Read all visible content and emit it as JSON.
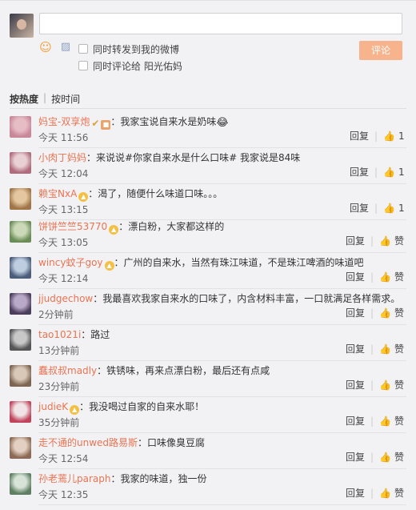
{
  "composer": {
    "input_value": "",
    "option_forward": "同时转发到我的微博",
    "option_comment": "同时评论给 阳光佑妈",
    "submit_label": "评论"
  },
  "sort": {
    "hot": "按热度",
    "separator": "|",
    "time": "按时间"
  },
  "comments": [
    {
      "username": "妈宝-双享炮",
      "badges": [
        "gold-v",
        "gift"
      ],
      "text": "：我家宝说自来水是奶味",
      "emoji": "😂",
      "time": "今天 11:56",
      "reply": "回复",
      "like_label": "1",
      "avatar": [
        "#e6bdc5",
        "#c9879a"
      ]
    },
    {
      "username": "小肉丁妈妈",
      "badges": [],
      "text": "：来说说#你家自来水是什么口味# 我家说是84味",
      "time": "今天 12:04",
      "reply": "回复",
      "like_label": "1",
      "avatar": [
        "#e9d0d5",
        "#b06c7c"
      ]
    },
    {
      "username": "赖宝NxA",
      "badges": [
        "vip"
      ],
      "text": "：渴了，随便什么味道口味。。。",
      "time": "今天 13:15",
      "reply": "回复",
      "like_label": "1",
      "avatar": [
        "#e4c7a0",
        "#a07648"
      ]
    },
    {
      "username": "饼饼竺竺53770",
      "badges": [
        "vip"
      ],
      "text": "：漂白粉，大家都这样的",
      "time": "今天 13:05",
      "reply": "回复",
      "like_label": "赞",
      "avatar": [
        "#cbd9b8",
        "#6b8d57"
      ]
    },
    {
      "username": "wincy蚊子goy",
      "badges": [
        "vip"
      ],
      "text": "：广州的自来水，当然有珠江味道，不是珠江啤酒的味道吧",
      "time": "今天 12:14",
      "reply": "回复",
      "like_label": "赞",
      "avatar": [
        "#bfcde0",
        "#4a5d7a"
      ]
    },
    {
      "username": "jjudgechow",
      "badges": [],
      "text": "：我最喜欢我家自来水的口味了，内含材料丰富，一口就满足各样需求。",
      "time": "2分钟前",
      "reply": "回复",
      "like_label": "赞",
      "avatar": [
        "#b9a9c9",
        "#4b3d5c"
      ]
    },
    {
      "username": "tao1021i",
      "badges": [],
      "text": "：路过",
      "time": "13分钟前",
      "reply": "回复",
      "like_label": "赞",
      "avatar": [
        "#c8c8c8",
        "#555555"
      ]
    },
    {
      "username": "蠢叔叔madly",
      "badges": [],
      "text": "：铁锈味，再来点漂白粉，最后还有点咸",
      "time": "23分钟前",
      "reply": "回复",
      "like_label": "赞",
      "avatar": [
        "#d9c7b7",
        "#7d6552"
      ]
    },
    {
      "username": "judieK",
      "badges": [
        "vip"
      ],
      "text": "：我没喝过自家的自来水耶！",
      "time": "35分钟前",
      "reply": "回复",
      "like_label": "赞",
      "avatar": [
        "#f0e4e6",
        "#c0455c"
      ]
    },
    {
      "username": "走不通的unwed路易斯",
      "badges": [],
      "text": "：口味像臭豆腐",
      "time": "今天 12:54",
      "reply": "回复",
      "like_label": "赞",
      "avatar": [
        "#e3d0c2",
        "#8c6a55"
      ]
    },
    {
      "username": "孙老蔫儿paraph",
      "badges": [],
      "text": "：我家的味道，独一份",
      "time": "今天 12:35",
      "reply": "回复",
      "like_label": "赞",
      "avatar": [
        "#d6e3d6",
        "#5f7f63"
      ]
    }
  ]
}
